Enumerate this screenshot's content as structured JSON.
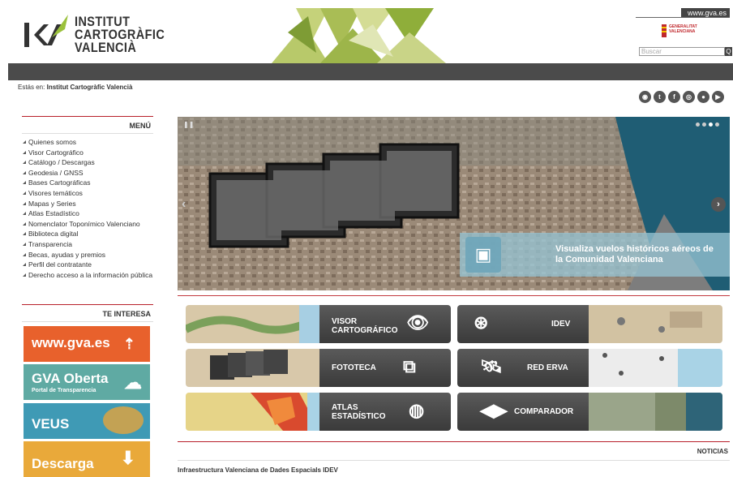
{
  "header": {
    "logo_lines": [
      "INSTITUT",
      "CARTOGRÀFIC",
      "VALENCIÀ"
    ],
    "gva_link": "www.gva.es",
    "generalitat_lines": [
      "GENERALITAT",
      "VALENCIANA"
    ],
    "search_placeholder": "Buscar",
    "search_button": "Q"
  },
  "breadcrumb": {
    "prefix": "Estás en:",
    "current": "Institut Cartogràfic Valencià"
  },
  "social_icons": [
    "rss-icon",
    "twitter-icon",
    "facebook-icon",
    "instagram-icon",
    "flickr-icon",
    "youtube-icon"
  ],
  "sidebar": {
    "menu_title": "MENÚ",
    "menu_items": [
      "Quienes somos",
      "Visor Cartográfico",
      "Catálogo / Descargas",
      "Geodesia / GNSS",
      "Bases Cartográficas",
      "Visores temáticos",
      "Mapas y Series",
      "Atlas Estadístico",
      "Nomenclator Toponímico Valenciano",
      "Biblioteca digital",
      "Transparencia",
      "Becas, ayudas y premios",
      "Perfil del contratante",
      "Derecho acceso a la información pública"
    ],
    "interesa_title": "TE INTERESA",
    "promos": [
      {
        "title": "www.gva.es",
        "subtitle": ""
      },
      {
        "title": "GVA Oberta",
        "subtitle": "Portal de Transparencia"
      },
      {
        "title": "VEUS",
        "subtitle": ""
      },
      {
        "title": "Descarga",
        "subtitle": ""
      }
    ]
  },
  "slider": {
    "caption": "Visualiza vuelos históricos aéreos de la Comunidad Valenciana",
    "slide_count": 4,
    "active_slide": 3
  },
  "tiles": [
    {
      "label": "VISOR CARTOGRÁFICO",
      "icon": "eye-icon"
    },
    {
      "label": "IDEV",
      "icon": "globe-search-icon"
    },
    {
      "label": "FOTOTECA",
      "icon": "photos-icon"
    },
    {
      "label": "RED ERVA",
      "icon": "satellite-icon"
    },
    {
      "label": "ATLAS ESTADÍSTICO",
      "icon": "globe-chart-icon"
    },
    {
      "label": "COMPARADOR",
      "icon": "compare-arrows-icon"
    }
  ],
  "news": {
    "title": "NOTICIAS",
    "first_item": "Infraestructura Valenciana de Dades Espacials IDEV"
  },
  "colors": {
    "accent_red": "#b8202a",
    "navbar": "#4b4b4b",
    "tile_dark": "#4a4a4a"
  }
}
